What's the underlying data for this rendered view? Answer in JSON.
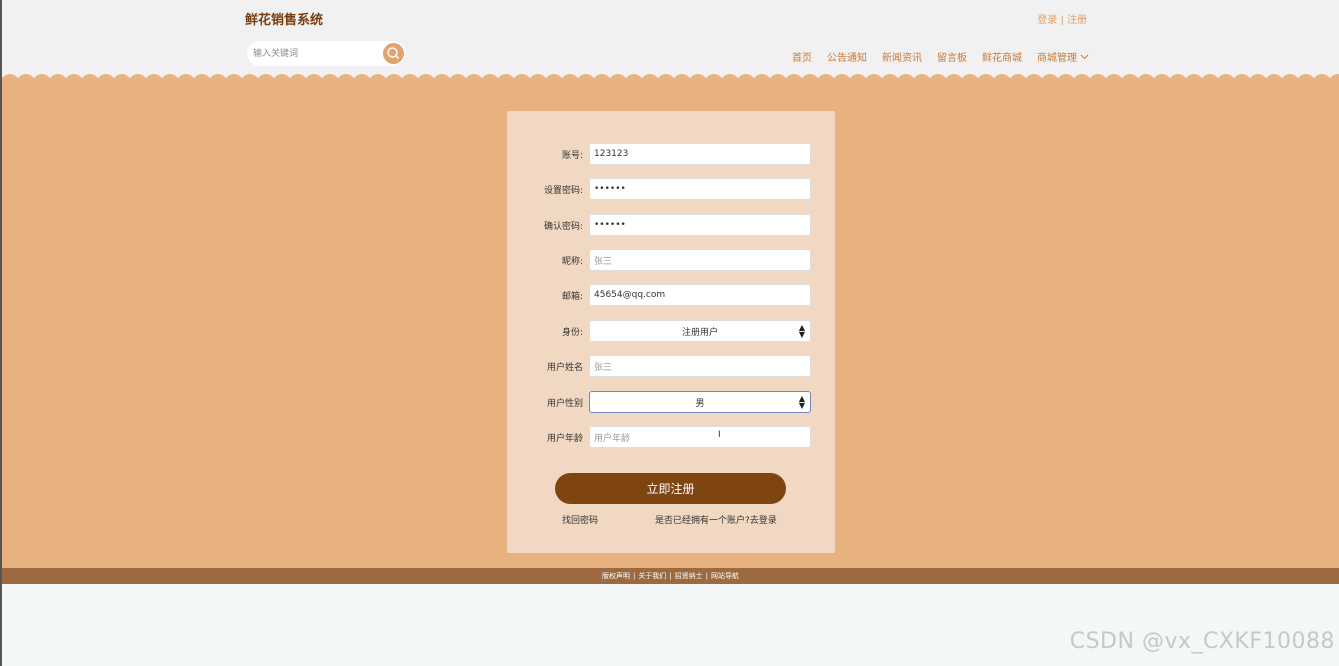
{
  "header": {
    "brand": "鲜花销售系统",
    "login": "登录",
    "separator": "|",
    "register": "注册",
    "search_placeholder": "输入关键词",
    "nav": [
      "首页",
      "公告通知",
      "新闻资讯",
      "留言板",
      "鲜花商城",
      "商城管理"
    ]
  },
  "form": {
    "fields": [
      {
        "label": "账号:",
        "value": "123123",
        "type": "text"
      },
      {
        "label": "设置密码:",
        "value": "••••••",
        "type": "password"
      },
      {
        "label": "确认密码:",
        "value": "••••••",
        "type": "password"
      },
      {
        "label": "昵称:",
        "placeholder": "张三",
        "type": "text"
      },
      {
        "label": "邮箱:",
        "value": "45654@qq.com",
        "type": "text"
      },
      {
        "label": "身份:",
        "value": "注册用户",
        "type": "select"
      },
      {
        "label": "用户姓名",
        "placeholder": "张三",
        "type": "text"
      },
      {
        "label": "用户性别",
        "value": "男",
        "type": "select"
      },
      {
        "label": "用户年龄",
        "placeholder": "用户年龄",
        "type": "text"
      }
    ],
    "submit": "立即注册",
    "forgot": "找回密码",
    "have_account": "是否已经拥有一个账户?去登录"
  },
  "footer": {
    "links": [
      "版权声明",
      "关于我们",
      "招贤纳士",
      "网站导航"
    ],
    "separator": "|"
  },
  "watermark": "CSDN @vx_CXKF10088",
  "colors": {
    "brand_text": "#7a3f10",
    "accent": "#e0a46c",
    "main_bg": "#e8b180",
    "card_bg": "#f0d8c2",
    "submit_bg": "#7f4510",
    "footer_bg": "#9c6a3e"
  }
}
